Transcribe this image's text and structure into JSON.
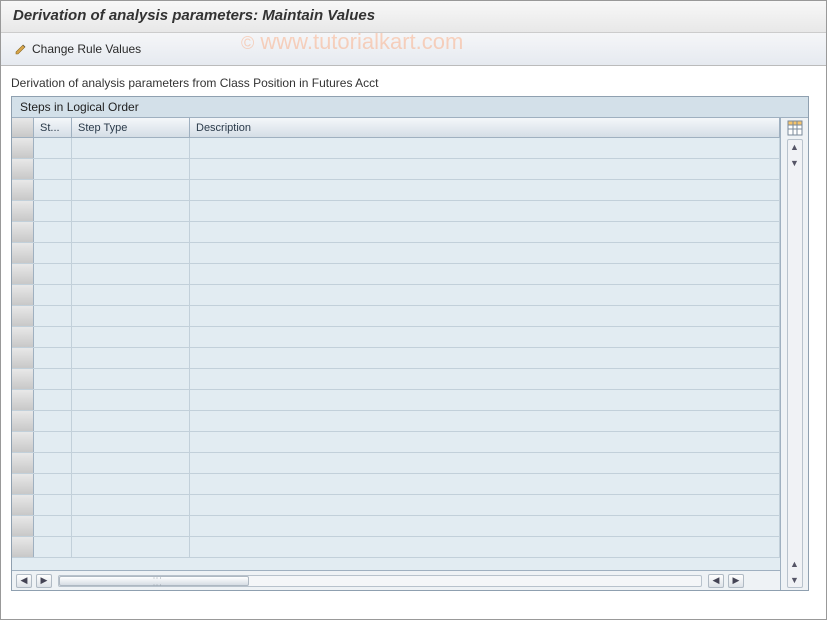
{
  "header": {
    "title": "Derivation of analysis parameters: Maintain Values"
  },
  "toolbar": {
    "change_rule_values_label": "Change Rule Values"
  },
  "content": {
    "label": "Derivation of analysis parameters from Class Position in Futures Acct"
  },
  "grid": {
    "title": "Steps in Logical Order",
    "columns": {
      "st": "St...",
      "step_type": "Step Type",
      "description": "Description"
    },
    "rows": [
      {
        "st": "",
        "step_type": "",
        "description": ""
      },
      {
        "st": "",
        "step_type": "",
        "description": ""
      },
      {
        "st": "",
        "step_type": "",
        "description": ""
      },
      {
        "st": "",
        "step_type": "",
        "description": ""
      },
      {
        "st": "",
        "step_type": "",
        "description": ""
      },
      {
        "st": "",
        "step_type": "",
        "description": ""
      },
      {
        "st": "",
        "step_type": "",
        "description": ""
      },
      {
        "st": "",
        "step_type": "",
        "description": ""
      },
      {
        "st": "",
        "step_type": "",
        "description": ""
      },
      {
        "st": "",
        "step_type": "",
        "description": ""
      },
      {
        "st": "",
        "step_type": "",
        "description": ""
      },
      {
        "st": "",
        "step_type": "",
        "description": ""
      },
      {
        "st": "",
        "step_type": "",
        "description": ""
      },
      {
        "st": "",
        "step_type": "",
        "description": ""
      },
      {
        "st": "",
        "step_type": "",
        "description": ""
      },
      {
        "st": "",
        "step_type": "",
        "description": ""
      },
      {
        "st": "",
        "step_type": "",
        "description": ""
      },
      {
        "st": "",
        "step_type": "",
        "description": ""
      },
      {
        "st": "",
        "step_type": "",
        "description": ""
      },
      {
        "st": "",
        "step_type": "",
        "description": ""
      }
    ]
  },
  "watermark": {
    "copy": "©",
    "text": "www.tutorialkart.com"
  }
}
